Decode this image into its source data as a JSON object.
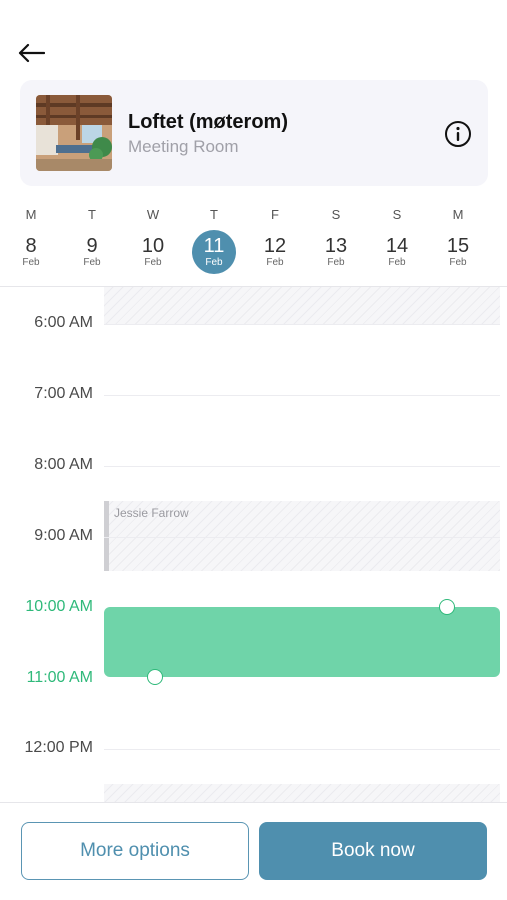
{
  "header": {
    "back_icon": "arrow-left-icon"
  },
  "room": {
    "name": "Loftet (møterom)",
    "type": "Meeting Room",
    "info_icon": "info-icon"
  },
  "days": [
    {
      "letter": "M",
      "num": "8",
      "month": "Feb",
      "selected": false
    },
    {
      "letter": "T",
      "num": "9",
      "month": "Feb",
      "selected": false
    },
    {
      "letter": "W",
      "num": "10",
      "month": "Feb",
      "selected": false
    },
    {
      "letter": "T",
      "num": "11",
      "month": "Feb",
      "selected": true
    },
    {
      "letter": "F",
      "num": "12",
      "month": "Feb",
      "selected": false
    },
    {
      "letter": "S",
      "num": "13",
      "month": "Feb",
      "selected": false
    },
    {
      "letter": "S",
      "num": "14",
      "month": "Feb",
      "selected": false
    },
    {
      "letter": "M",
      "num": "15",
      "month": "Feb",
      "selected": false
    }
  ],
  "hours": [
    "6:00 AM",
    "7:00 AM",
    "8:00 AM",
    "9:00 AM",
    "10:00 AM",
    "11:00 AM",
    "12:00 PM"
  ],
  "booking": {
    "name": "Jessie Farrow"
  },
  "selection": {
    "start": "10:00 AM",
    "end": "11:00 AM"
  },
  "colors": {
    "accent": "#4f8fae",
    "selection": "#6fd4a9",
    "active_time": "#2fb97a"
  },
  "actions": {
    "more_options": "More options",
    "book_now": "Book now"
  }
}
